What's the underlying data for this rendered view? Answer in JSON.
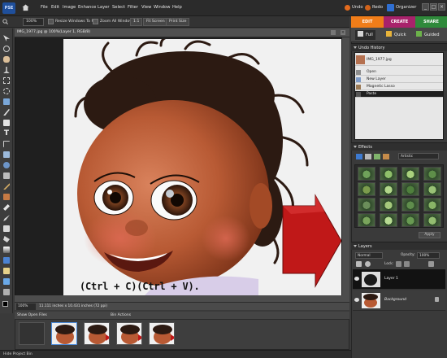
{
  "menubar": {
    "app_logo": "PSE",
    "items": [
      "File",
      "Edit",
      "Image",
      "Enhance",
      "Layer",
      "Select",
      "Filter",
      "View",
      "Window",
      "Help"
    ],
    "undo_label": "Undo",
    "redo_label": "Redo",
    "organizer_label": "Organizer"
  },
  "options_bar": {
    "zoom_value": "100%",
    "resize_windows_label": "Resize Windows To Fit",
    "zoom_all_windows_label": "Zoom All Windows",
    "one_to_one_label": "1:1",
    "fit_screen_label": "Fit Screen",
    "print_size_label": "Print Size"
  },
  "mode_tabs": {
    "edit": "EDIT",
    "create": "CREATE",
    "share": "SHARE"
  },
  "edit_modes": {
    "full": "Full",
    "quick": "Quick",
    "guided": "Guided"
  },
  "document": {
    "title": "IMG_1977.jpg @ 100%(Layer 1, RGB/8)",
    "zoom": "100%",
    "status": "11.111 inches x 10.431 inches (72 ppi)",
    "shortcut_caption": "(Ctrl + C)(Ctrl + V)."
  },
  "project_bin": {
    "show_open_files": "Show Open Files",
    "bin_actions": "Bin Actions",
    "hide_project_bin": "Hide Project Bin"
  },
  "undo_history": {
    "title": "Undo History",
    "items": [
      {
        "label": "IMG_1977.jpg"
      },
      {
        "label": "Open"
      },
      {
        "label": "New Layer"
      },
      {
        "label": "Magnetic Lasso"
      },
      {
        "label": "Paste"
      }
    ],
    "selected_index": 4
  },
  "effects": {
    "title": "Effects",
    "category": "Artistic",
    "apply_label": "Apply"
  },
  "layers": {
    "title": "Layers",
    "blend_mode": "Normal",
    "opacity_label": "Opacity:",
    "opacity_value": "100%",
    "lock_label": "Lock:",
    "items": [
      {
        "name": "Layer 1"
      },
      {
        "name": "Background"
      }
    ]
  },
  "colors": {
    "edit_tab": "#f07d19",
    "create_tab": "#a8226b",
    "share_tab": "#2f8a3b",
    "arrow": "#c01818"
  }
}
